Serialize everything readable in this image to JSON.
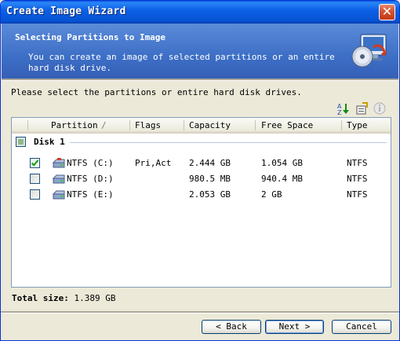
{
  "window": {
    "title": "Create Image Wizard",
    "close_glyph": "✕"
  },
  "header": {
    "title": "Selecting Partitions to Image",
    "subtitle": "You can create an image of selected partitions or an entire hard disk drive.",
    "icon": "disk-image-wizard-icon"
  },
  "instructions": "Please select the partitions or entire hard disk drives.",
  "toolbar": {
    "icons": [
      "sort-icon",
      "properties-icon",
      "info-icon"
    ]
  },
  "table": {
    "columns": [
      "Partition",
      "Flags",
      "Capacity",
      "Free Space",
      "Type"
    ],
    "sort_glyph": "/",
    "groups": [
      {
        "label": "Disk 1",
        "rows": [
          {
            "partition": "NTFS (C:)",
            "flags": "Pri,Act",
            "capacity": "2.444 GB",
            "free": "1.054 GB",
            "type": "NTFS",
            "checked": true
          },
          {
            "partition": "NTFS (D:)",
            "flags": "",
            "capacity": "980.5 MB",
            "free": "940.4 MB",
            "type": "NTFS",
            "checked": false
          },
          {
            "partition": "NTFS (E:)",
            "flags": "",
            "capacity": "2.053 GB",
            "free": "2 GB",
            "type": "NTFS",
            "checked": false
          }
        ]
      }
    ]
  },
  "total": {
    "label": "Total size:",
    "value": "1.389 GB"
  },
  "buttons": {
    "back": "< Back",
    "next": "Next >",
    "cancel": "Cancel"
  },
  "colors": {
    "title_bar": "#0553d3",
    "header_band": "#3d6fc6",
    "face": "#ece9d8",
    "check": "#21a121"
  }
}
